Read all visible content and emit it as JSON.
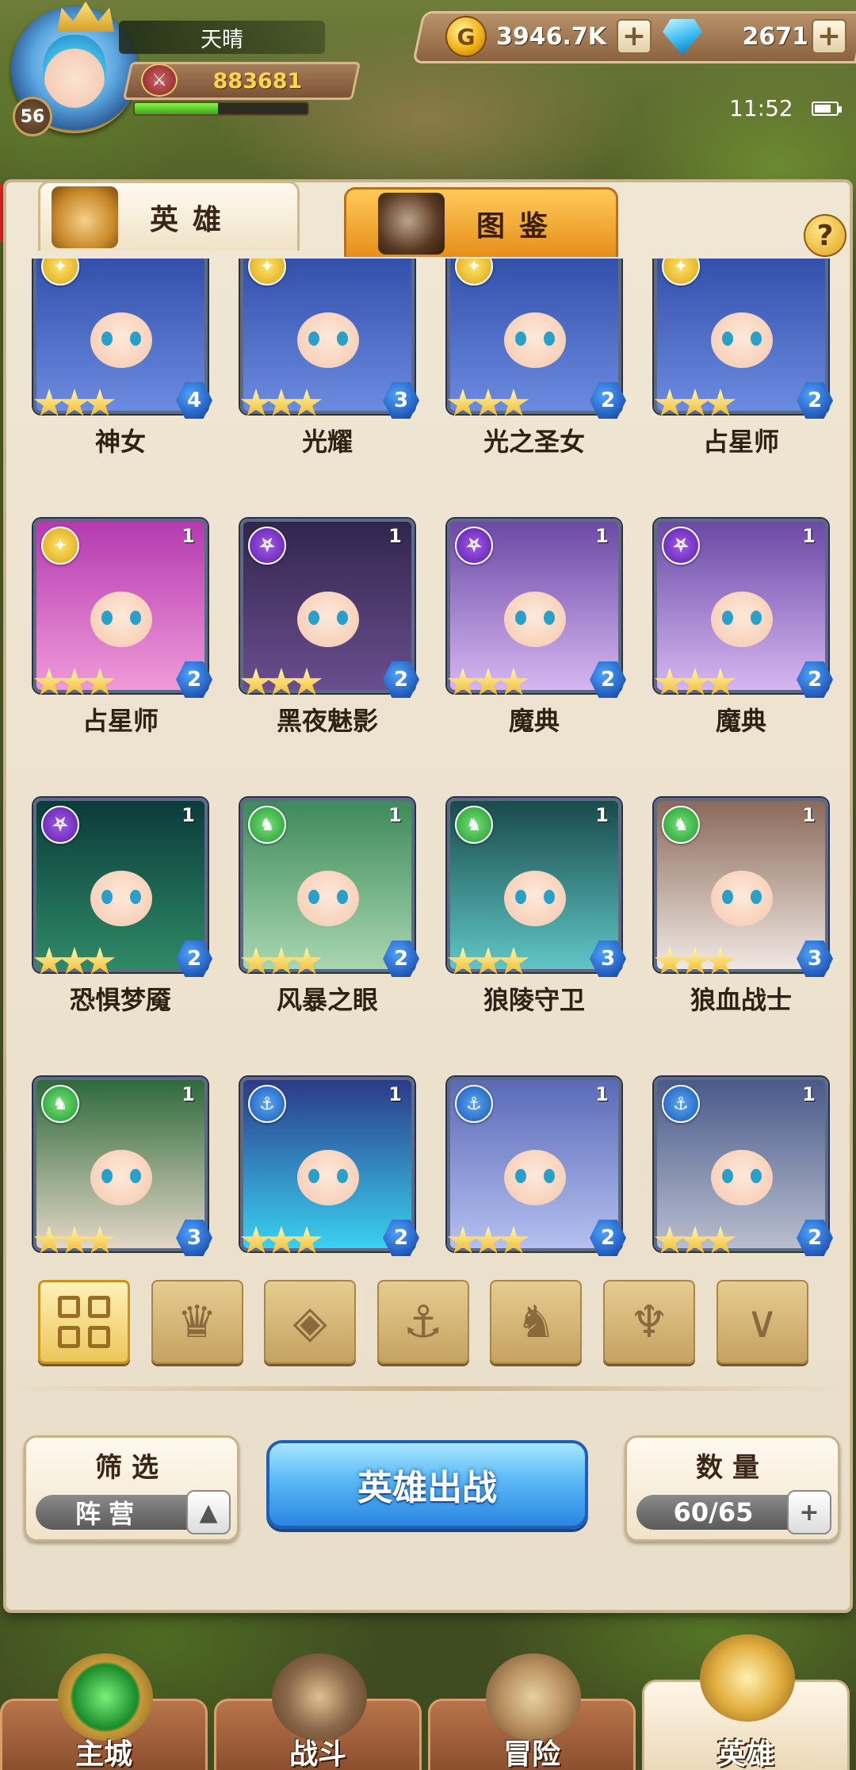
{
  "player": {
    "name": "天晴",
    "level": "56",
    "power": "883681",
    "exp_progress": 0.48
  },
  "resources": {
    "gold": "3946.7K",
    "gems": "2671",
    "gold_glyph": "G",
    "plus": "+"
  },
  "status": {
    "time": "11:52"
  },
  "tabs": {
    "heroes": "英雄",
    "codex": "图鉴"
  },
  "help_label": "?",
  "heroes": [
    {
      "name": "神女",
      "faction": "light",
      "stars": 3,
      "level": "4",
      "copies": ""
    },
    {
      "name": "光耀",
      "faction": "light",
      "stars": 3,
      "level": "3",
      "copies": ""
    },
    {
      "name": "光之圣女",
      "faction": "light",
      "stars": 3,
      "level": "2",
      "copies": ""
    },
    {
      "name": "占星师",
      "faction": "light",
      "stars": 3,
      "level": "2",
      "copies": ""
    },
    {
      "name": "占星师",
      "faction": "light",
      "stars": 3,
      "level": "2",
      "copies": "1"
    },
    {
      "name": "黑夜魅影",
      "faction": "dark",
      "stars": 3,
      "level": "2",
      "copies": "1"
    },
    {
      "name": "魔典",
      "faction": "dark",
      "stars": 3,
      "level": "2",
      "copies": "1"
    },
    {
      "name": "魔典",
      "faction": "dark",
      "stars": 3,
      "level": "2",
      "copies": "1"
    },
    {
      "name": "恐惧梦魇",
      "faction": "dark",
      "stars": 3,
      "level": "2",
      "copies": "1"
    },
    {
      "name": "风暴之眼",
      "faction": "beast",
      "stars": 3,
      "level": "2",
      "copies": "1"
    },
    {
      "name": "狼陵守卫",
      "faction": "beast",
      "stars": 3,
      "level": "3",
      "copies": "1"
    },
    {
      "name": "狼血战士",
      "faction": "beast",
      "stars": 3,
      "level": "3",
      "copies": "1"
    },
    {
      "name": "",
      "faction": "beast",
      "stars": 3,
      "level": "3",
      "copies": "1"
    },
    {
      "name": "",
      "faction": "sea",
      "stars": 3,
      "level": "2",
      "copies": "1"
    },
    {
      "name": "",
      "faction": "sea",
      "stars": 3,
      "level": "2",
      "copies": "1"
    },
    {
      "name": "",
      "faction": "sea",
      "stars": 3,
      "level": "2",
      "copies": "1"
    }
  ],
  "faction_filters": [
    {
      "name": "all-factions-filter",
      "icon": "grid-icon",
      "active": true
    },
    {
      "name": "nature-faction-filter",
      "icon": "leaf-crown-icon",
      "active": false
    },
    {
      "name": "order-faction-filter",
      "icon": "diamond-chevron-icon",
      "active": false
    },
    {
      "name": "sea-faction-filter",
      "icon": "anchor-icon",
      "active": false
    },
    {
      "name": "beast-faction-filter",
      "icon": "beast-head-icon",
      "active": false
    },
    {
      "name": "dark-faction-filter",
      "icon": "horned-icon",
      "active": false
    },
    {
      "name": "light-faction-filter",
      "icon": "wing-chevron-icon",
      "active": false
    }
  ],
  "filter_panel": {
    "title": "筛选",
    "value": "阵营"
  },
  "deploy_button": "英雄出战",
  "count_panel": {
    "title": "数量",
    "value": "60/65"
  },
  "nav": [
    {
      "label": "主城",
      "active": false
    },
    {
      "label": "战斗",
      "active": false
    },
    {
      "label": "冒险",
      "active": false
    },
    {
      "label": "英雄",
      "active": true
    }
  ]
}
